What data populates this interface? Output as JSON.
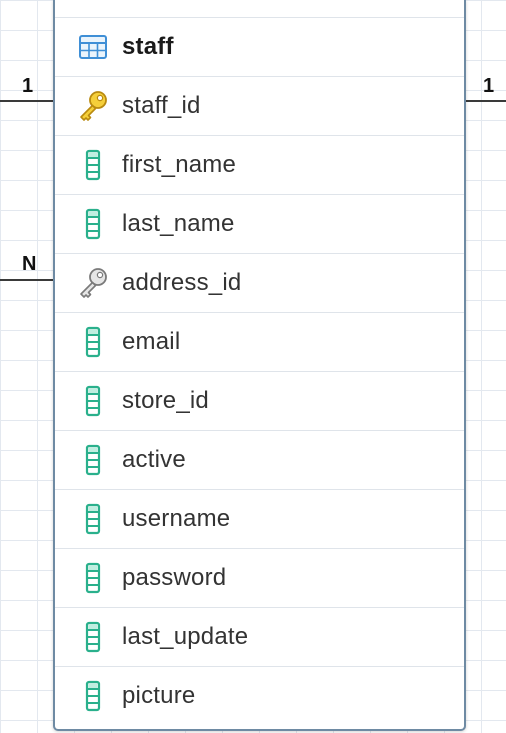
{
  "relations": {
    "left_top_cardinality": "1",
    "left_bottom_cardinality": "N",
    "right_top_cardinality": "1"
  },
  "table": {
    "name": "staff",
    "icon": "table-grid-icon",
    "columns": [
      {
        "name": "staff_id",
        "icon": "primary-key-icon",
        "color": "#e8b82a"
      },
      {
        "name": "first_name",
        "icon": "column-icon",
        "color": "#2ab08c"
      },
      {
        "name": "last_name",
        "icon": "column-icon",
        "color": "#2ab08c"
      },
      {
        "name": "address_id",
        "icon": "foreign-key-icon",
        "color": "#9a9a9a"
      },
      {
        "name": "email",
        "icon": "column-icon",
        "color": "#2ab08c"
      },
      {
        "name": "store_id",
        "icon": "column-icon",
        "color": "#2ab08c"
      },
      {
        "name": "active",
        "icon": "column-icon",
        "color": "#2ab08c"
      },
      {
        "name": "username",
        "icon": "column-icon",
        "color": "#2ab08c"
      },
      {
        "name": "password",
        "icon": "column-icon",
        "color": "#2ab08c"
      },
      {
        "name": "last_update",
        "icon": "column-icon",
        "color": "#2ab08c"
      },
      {
        "name": "picture",
        "icon": "column-icon",
        "color": "#2ab08c"
      }
    ]
  },
  "colors": {
    "border": "#6e8aa3",
    "table_icon": "#3f8fd6",
    "grid": "#e3e8ef"
  }
}
